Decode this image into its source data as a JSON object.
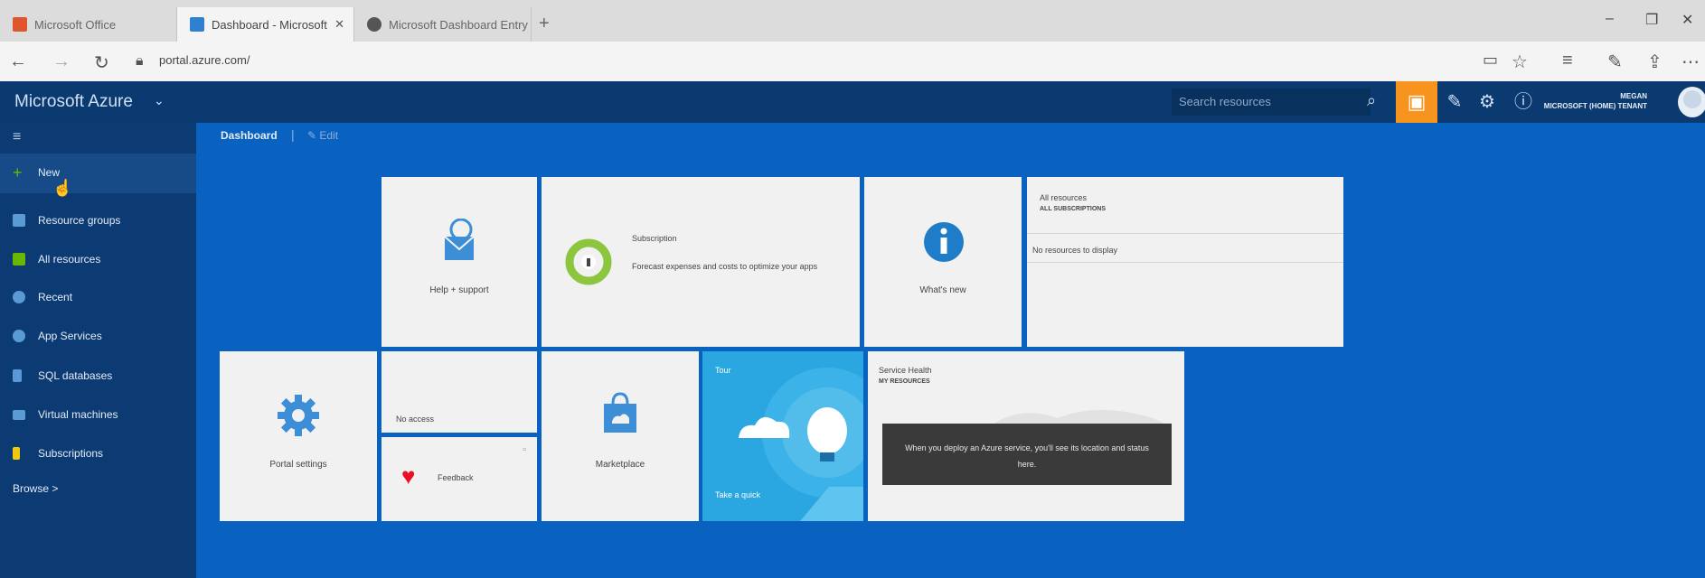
{
  "browser": {
    "tabs": [
      {
        "label": "Microsoft Office"
      },
      {
        "label": "Dashboard - Microsoft"
      },
      {
        "label": "Microsoft Dashboard Entry"
      }
    ],
    "url": "portal.azure.com/"
  },
  "header": {
    "brand": "Microsoft Azure",
    "search_placeholder": "Search resources",
    "user_name": "MEGAN",
    "user_org": "MICROSOFT (HOME) TENANT"
  },
  "sidebar": {
    "items": [
      {
        "label": "New",
        "icon": "plus-icon",
        "color": "#6bb700"
      },
      {
        "label": "Resource groups",
        "icon": "cube-icon",
        "color": "#5b9bd5"
      },
      {
        "label": "All resources",
        "icon": "grid-icon",
        "color": "#6bb700"
      },
      {
        "label": "Recent",
        "icon": "clock-icon",
        "color": "#5b9bd5"
      },
      {
        "label": "App Services",
        "icon": "globe-icon",
        "color": "#5b9bd5"
      },
      {
        "label": "SQL databases",
        "icon": "database-icon",
        "color": "#5b9bd5"
      },
      {
        "label": "Virtual machines",
        "icon": "monitor-icon",
        "color": "#5b9bd5"
      },
      {
        "label": "Subscriptions",
        "icon": "key-icon",
        "color": "#f2c811"
      }
    ],
    "browse_label": "Browse >"
  },
  "breadcrumb": {
    "title": "Dashboard",
    "edit_label": "Edit"
  },
  "tiles": {
    "help": {
      "label": "Help + support"
    },
    "subscription": {
      "title": "Subscription",
      "desc": "Forecast expenses and costs to optimize your apps"
    },
    "whats_new": {
      "label": "What's new"
    },
    "all_resources": {
      "title": "All resources",
      "subtitle": "ALL SUBSCRIPTIONS",
      "empty": "No resources to display"
    },
    "portal_settings": {
      "label": "Portal settings"
    },
    "access": {
      "label": "No access"
    },
    "feedback": {
      "label": "Feedback"
    },
    "marketplace": {
      "label": "Marketplace"
    },
    "tour": {
      "title": "Tour",
      "footer": "Take a quick"
    },
    "service_health": {
      "title": "Service Health",
      "subtitle": "MY RESOURCES",
      "tooltip": "When you deploy an Azure service, you'll see its location and status here."
    }
  },
  "colors": {
    "azure_blue": "#0a62c0",
    "header_navy": "#0b3a70",
    "accent_orange": "#f7941d",
    "tile_bg": "#f1f1f1",
    "tour_blue": "#2aa6e0"
  }
}
